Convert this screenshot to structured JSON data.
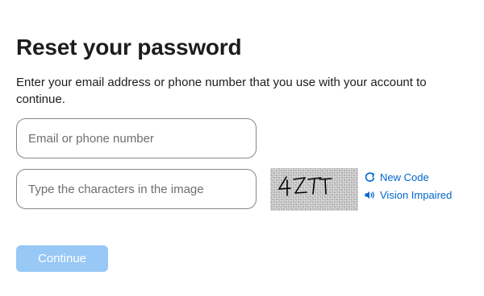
{
  "page": {
    "title": "Reset your password",
    "description": "Enter your email address or phone number that you use with your account to continue."
  },
  "form": {
    "email_placeholder": "Email or phone number",
    "email_value": "",
    "captcha_placeholder": "Type the characters in the image",
    "captcha_value": "",
    "captcha_image_text": "4ZTT"
  },
  "links": {
    "new_code_label": "New Code",
    "new_code_icon": "refresh-icon",
    "vision_impaired_label": "Vision Impaired",
    "vision_impaired_icon": "speaker-icon"
  },
  "actions": {
    "continue_label": "Continue"
  },
  "colors": {
    "link": "#0066cc",
    "button_disabled": "#98c8f5",
    "field_border": "#86868b",
    "text": "#1d1d1f"
  }
}
